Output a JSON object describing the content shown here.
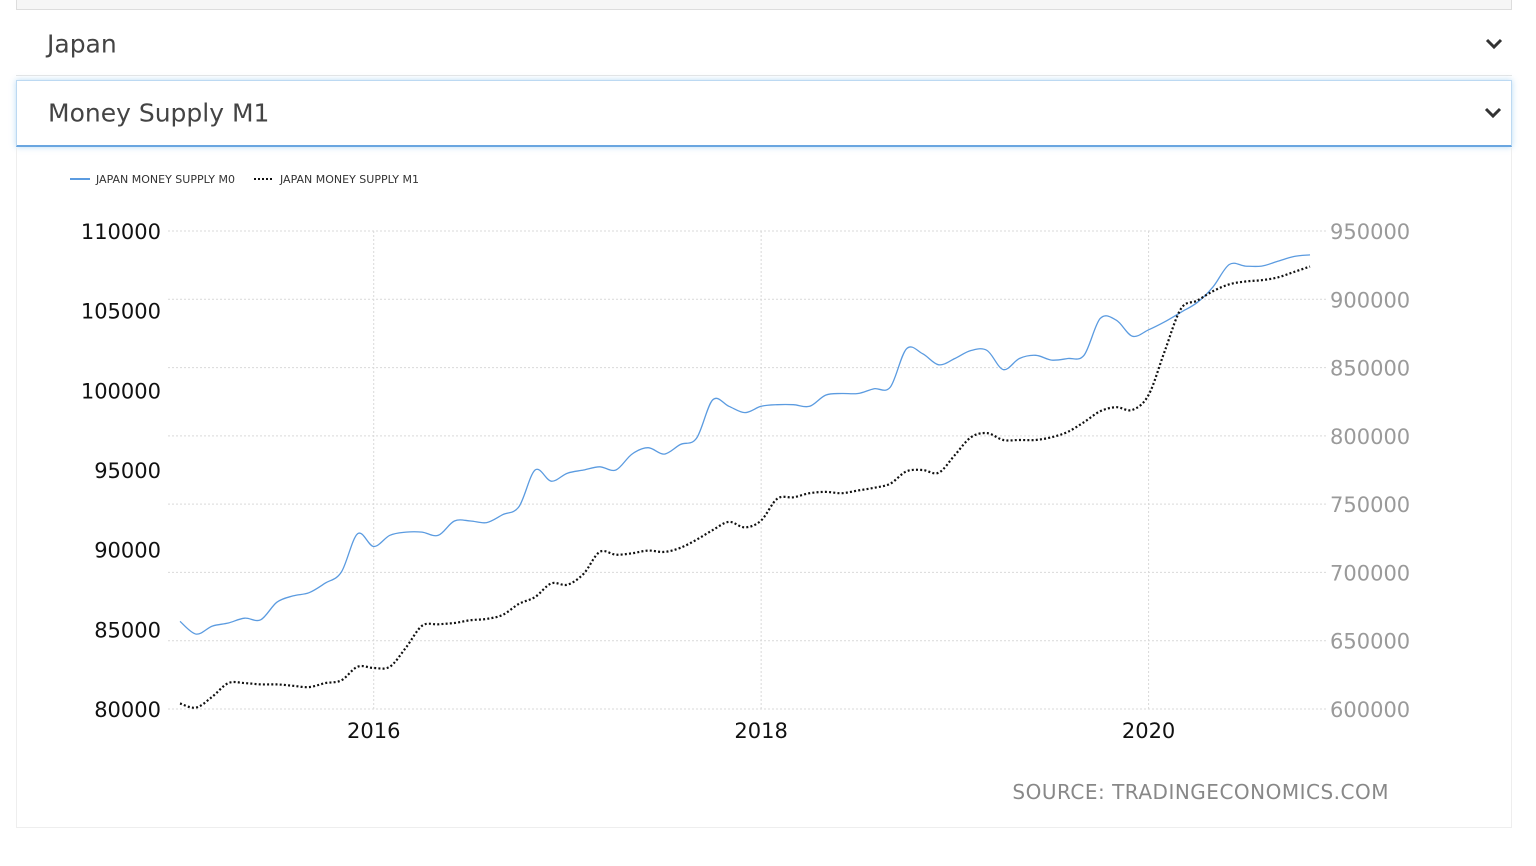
{
  "filters": {
    "country": "Japan",
    "indicator": "Money Supply M1"
  },
  "colors": {
    "m0": "#5b9be0",
    "m1": "#111111",
    "grid": "#d9d9d9",
    "right_axis_text": "#9a9a9a"
  },
  "icons": {
    "dropdown": "chevron-down-icon"
  },
  "source": "SOURCE: TRADINGECONOMICS.COM",
  "chart_data": {
    "type": "line",
    "title": "",
    "legend": {
      "placement": "top-left",
      "entries": [
        "JAPAN MONEY SUPPLY M0",
        "JAPAN MONEY SUPPLY M1"
      ]
    },
    "grid": true,
    "x_ticks": [
      "2016",
      "2018",
      "2020"
    ],
    "x_range": [
      "2015-01",
      "2020-11"
    ],
    "y_left": {
      "ylim": [
        80000,
        110000
      ],
      "ticks": [
        "110000",
        "105000",
        "100000",
        "95000",
        "90000",
        "85000",
        "80000"
      ]
    },
    "y_right": {
      "ylim": [
        600000,
        950000
      ],
      "ticks": [
        "950000",
        "900000",
        "850000",
        "800000",
        "750000",
        "700000",
        "650000",
        "600000"
      ]
    },
    "x": [
      "2015-01",
      "2015-02",
      "2015-03",
      "2015-04",
      "2015-05",
      "2015-06",
      "2015-07",
      "2015-08",
      "2015-09",
      "2015-10",
      "2015-11",
      "2015-12",
      "2016-01",
      "2016-02",
      "2016-03",
      "2016-04",
      "2016-05",
      "2016-06",
      "2016-07",
      "2016-08",
      "2016-09",
      "2016-10",
      "2016-11",
      "2016-12",
      "2017-01",
      "2017-02",
      "2017-03",
      "2017-04",
      "2017-05",
      "2017-06",
      "2017-07",
      "2017-08",
      "2017-09",
      "2017-10",
      "2017-11",
      "2017-12",
      "2018-01",
      "2018-02",
      "2018-03",
      "2018-04",
      "2018-05",
      "2018-06",
      "2018-07",
      "2018-08",
      "2018-09",
      "2018-10",
      "2018-11",
      "2018-12",
      "2019-01",
      "2019-02",
      "2019-03",
      "2019-04",
      "2019-05",
      "2019-06",
      "2019-07",
      "2019-08",
      "2019-09",
      "2019-10",
      "2019-11",
      "2019-12",
      "2020-01",
      "2020-02",
      "2020-03",
      "2020-04",
      "2020-05",
      "2020-06",
      "2020-07",
      "2020-08",
      "2020-09",
      "2020-10",
      "2020-11"
    ],
    "series": [
      {
        "name": "JAPAN MONEY SUPPLY M0",
        "axis": "left",
        "style": "solid",
        "values": [
          85500,
          84700,
          85200,
          85400,
          85700,
          85600,
          86700,
          87100,
          87300,
          87900,
          88600,
          91000,
          90200,
          90900,
          91100,
          91100,
          90900,
          91800,
          91800,
          91700,
          92200,
          92700,
          95000,
          94300,
          94800,
          95000,
          95200,
          95000,
          96000,
          96400,
          96000,
          96600,
          97000,
          99400,
          99000,
          98600,
          99000,
          99100,
          99100,
          99000,
          99700,
          99800,
          99800,
          100100,
          100200,
          102600,
          102300,
          101600,
          102000,
          102500,
          102500,
          101300,
          102000,
          102200,
          101900,
          102000,
          102200,
          104500,
          104400,
          103400,
          103800,
          104300,
          104900,
          105500,
          106500,
          107900,
          107800,
          107800,
          108100,
          108400,
          108500
        ]
      },
      {
        "name": "JAPAN MONEY SUPPLY M1",
        "axis": "right",
        "style": "dotted",
        "values": [
          604000,
          601000,
          609000,
          619000,
          619000,
          618000,
          618000,
          617000,
          616000,
          619000,
          621000,
          631000,
          630000,
          631000,
          645000,
          661000,
          662000,
          663000,
          665000,
          666000,
          669000,
          677000,
          682000,
          692000,
          691000,
          699000,
          715000,
          713000,
          714000,
          716000,
          715000,
          718000,
          724000,
          731000,
          737000,
          733000,
          738000,
          754000,
          755000,
          758000,
          759000,
          758000,
          760000,
          762000,
          765000,
          774000,
          775000,
          773000,
          786000,
          799000,
          802000,
          797000,
          797000,
          797000,
          799000,
          803000,
          810000,
          818000,
          821000,
          819000,
          830000,
          862000,
          893000,
          899000,
          906000,
          911000,
          913000,
          914000,
          916000,
          920000,
          924000
        ]
      }
    ]
  }
}
